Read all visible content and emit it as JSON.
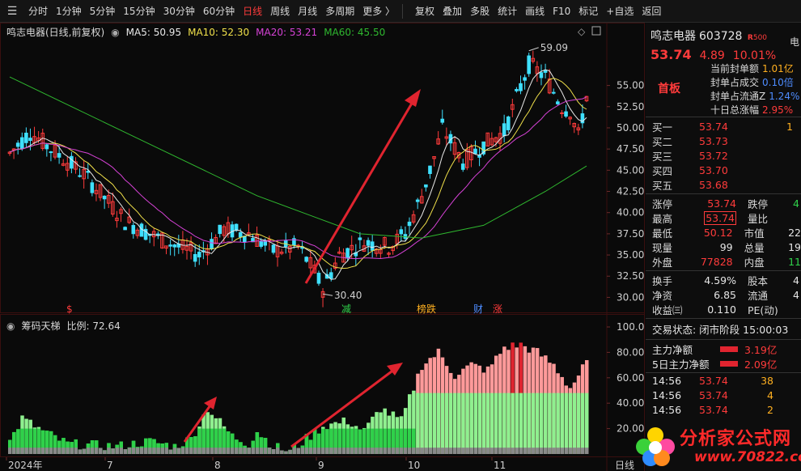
{
  "toolbar": {
    "periods": [
      "分时",
      "1分钟",
      "5分钟",
      "15分钟",
      "30分钟",
      "60分钟",
      "日线",
      "周线",
      "月线",
      "多周期",
      "更多 〉"
    ],
    "active_period": "日线",
    "tools": [
      "复权",
      "叠加",
      "多股",
      "统计",
      "画线",
      "F10",
      "标记",
      "+自选",
      "返回"
    ]
  },
  "price_legend": {
    "name": "鸣志电器(日线,前复权)",
    "ma5": "MA5: 50.95",
    "ma10": "MA10: 52.30",
    "ma20": "MA20: 53.21",
    "ma60": "MA60: 45.50"
  },
  "colors": {
    "up": "#ff3b3b",
    "down": "#3fe0ff",
    "ma5": "#e8e8e8",
    "ma10": "#f0e04a",
    "ma20": "#d642d6",
    "ma60": "#2fb82f"
  },
  "price_axis": [
    "55.00",
    "52.50",
    "50.00",
    "47.50",
    "45.00",
    "42.50",
    "40.00",
    "37.50",
    "35.00",
    "32.50",
    "30.00"
  ],
  "price_annotations": {
    "high": "59.09",
    "low": "30.40"
  },
  "event_markers": [
    {
      "text": "$",
      "color": "#ff3b3b"
    },
    {
      "text": "减",
      "color": "#2fd14a"
    },
    {
      "text": "榜跌",
      "color": "#ffb020"
    },
    {
      "text": "财",
      "color": "#4d8cff"
    },
    {
      "text": "涨",
      "color": "#ff3b3b"
    }
  ],
  "indicator_legend": {
    "name": "筹码天梯",
    "ratio": "比例: 72.64"
  },
  "indicator_axis": [
    "100.0",
    "80.00",
    "60.00",
    "40.00",
    "20.00"
  ],
  "x_axis": [
    "2024年",
    "7",
    "8",
    "9",
    "10",
    "11",
    "日线"
  ],
  "right_panel": {
    "stock_name": "鸣志电器",
    "stock_code": "603728",
    "r_tag": "R",
    "r_num": "500",
    "top_right": "电",
    "last_price": "53.74",
    "change": "4.89",
    "change_pct": "10.01%",
    "limit_label": "首板",
    "seal_rows": [
      {
        "label": "当前封单额",
        "value": "1.01亿",
        "color": "yellow"
      },
      {
        "label": "封单占成交",
        "value": "0.10倍",
        "color": "blue"
      },
      {
        "label": "封单占流通Z",
        "value": "1.24%",
        "color": "blue"
      },
      {
        "label": "十日总涨幅",
        "value": "2.95%",
        "color": "red"
      }
    ],
    "book": [
      {
        "label": "买一",
        "price": "53.74",
        "qty": "1"
      },
      {
        "label": "买二",
        "price": "53.73",
        "qty": ""
      },
      {
        "label": "买三",
        "price": "53.72",
        "qty": ""
      },
      {
        "label": "买四",
        "price": "53.70",
        "qty": ""
      },
      {
        "label": "买五",
        "price": "53.68",
        "qty": ""
      }
    ],
    "quote": [
      {
        "l1": "涨停",
        "v1": "53.74",
        "c1": "red",
        "l2": "跌停",
        "v2": "4",
        "c2": "green"
      },
      {
        "l1": "最高",
        "v1": "53.74",
        "c1": "red boxed",
        "l2": "量比",
        "v2": "",
        "c2": "white"
      },
      {
        "l1": "最低",
        "v1": "50.12",
        "c1": "red",
        "l2": "市值",
        "v2": "22",
        "c2": "white"
      },
      {
        "l1": "现量",
        "v1": "99",
        "c1": "white",
        "l2": "总量",
        "v2": "19",
        "c2": "white"
      },
      {
        "l1": "外盘",
        "v1": "77828",
        "c1": "red",
        "l2": "内盘",
        "v2": "11",
        "c2": "green"
      }
    ],
    "quote2": [
      {
        "l1": "换手",
        "v1": "4.59%",
        "c1": "white",
        "l2": "股本",
        "v2": "4",
        "c2": "white"
      },
      {
        "l1": "净资",
        "v1": "6.85",
        "c1": "white",
        "l2": "流通",
        "v2": "4",
        "c2": "white"
      },
      {
        "l1": "收益㈢",
        "v1": "0.110",
        "c1": "white",
        "l2": "PE(动)",
        "v2": "",
        "c2": "white"
      }
    ],
    "trade_status": "交易状态: 闭市阶段 15:00:03",
    "flows": [
      {
        "label": "主力净额",
        "value": "3.19亿"
      },
      {
        "label": "5日主力净额",
        "value": "2.09亿"
      }
    ],
    "trades": [
      {
        "time": "14:56",
        "price": "53.74",
        "qty": "38"
      },
      {
        "time": "14:56",
        "price": "53.74",
        "qty": "4"
      },
      {
        "time": "14:56",
        "price": "53.74",
        "qty": "2"
      }
    ]
  },
  "watermark": {
    "title": "分析家公式网",
    "url": "www.70822.com"
  }
}
